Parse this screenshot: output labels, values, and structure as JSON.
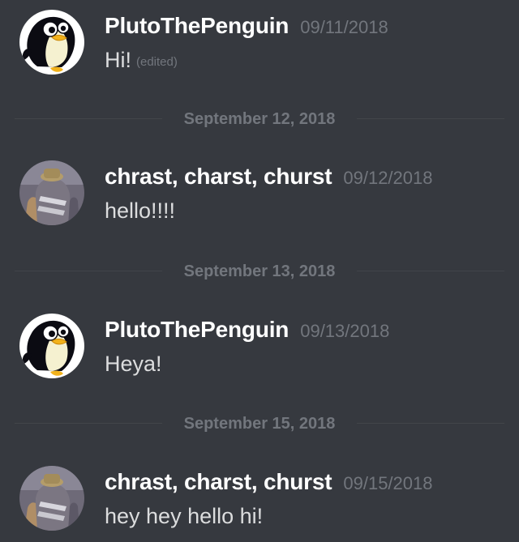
{
  "messages": [
    {
      "author": "PlutoThePenguin",
      "timestamp": "09/11/2018",
      "text": "Hi!",
      "edited_label": "(edited)",
      "avatar": "penguin-avatar"
    },
    {
      "author": "chrast, charst, churst",
      "timestamp": "09/12/2018",
      "text": "hello!!!!",
      "avatar": "photo-avatar"
    },
    {
      "author": "PlutoThePenguin",
      "timestamp": "09/13/2018",
      "text": "Heya!",
      "avatar": "penguin-avatar"
    },
    {
      "author": "chrast, charst, churst",
      "timestamp": "09/15/2018",
      "text": "hey hey hello hi!",
      "avatar": "photo-avatar"
    }
  ],
  "dividers": [
    {
      "label": "September 12, 2018"
    },
    {
      "label": "September 13, 2018"
    },
    {
      "label": "September 15, 2018"
    }
  ],
  "colors": {
    "background": "#36393f",
    "username": "#ffffff",
    "timestamp": "#72767d",
    "message_text": "#dcddde",
    "divider_line": "#42454a"
  }
}
